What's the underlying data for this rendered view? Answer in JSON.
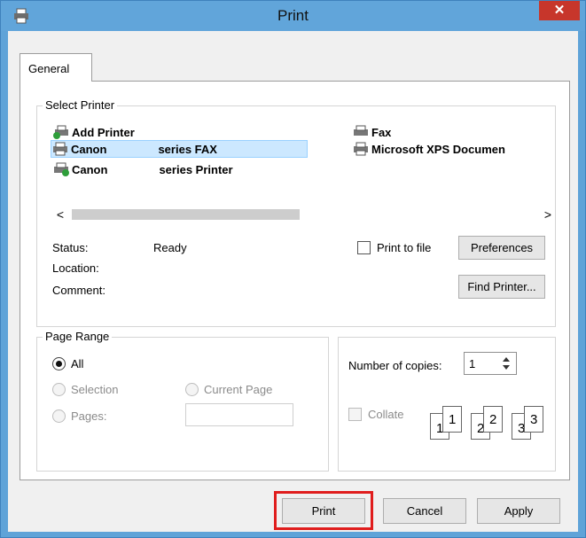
{
  "window": {
    "title": "Print",
    "close_glyph": "✕"
  },
  "tabs": [
    {
      "label": "General"
    }
  ],
  "select_printer": {
    "legend": "Select Printer",
    "printers": [
      {
        "name": "Add Printer",
        "icon": "add-printer-icon"
      },
      {
        "name_prefix": "Canon",
        "name_suffix": "series FAX",
        "icon": "fax-printer-icon",
        "selected": true
      },
      {
        "name_prefix": "Canon",
        "name_suffix": "series Printer",
        "icon": "default-printer-icon"
      },
      {
        "name": "Fax",
        "icon": "fax-icon"
      },
      {
        "name": "Microsoft XPS Documen",
        "icon": "printer-icon"
      }
    ],
    "scroll_left": "<",
    "scroll_right": ">",
    "status_label": "Status:",
    "status_value": "Ready",
    "location_label": "Location:",
    "comment_label": "Comment:",
    "print_to_file": "Print to file",
    "preferences": "Preferences",
    "find_printer": "Find Printer..."
  },
  "page_range": {
    "legend": "Page Range",
    "all": "All",
    "selection": "Selection",
    "current_page": "Current Page",
    "pages": "Pages:"
  },
  "copies": {
    "label": "Number of copies:",
    "value": "1",
    "collate": "Collate",
    "collate_pages": [
      "1",
      "1",
      "2",
      "2",
      "3",
      "3"
    ]
  },
  "buttons": {
    "print": "Print",
    "cancel": "Cancel",
    "apply": "Apply"
  },
  "colors": {
    "title_bar": "#61a5da",
    "close": "#c7362b",
    "selection": "#cce8ff",
    "highlight": "#e01d1d"
  }
}
